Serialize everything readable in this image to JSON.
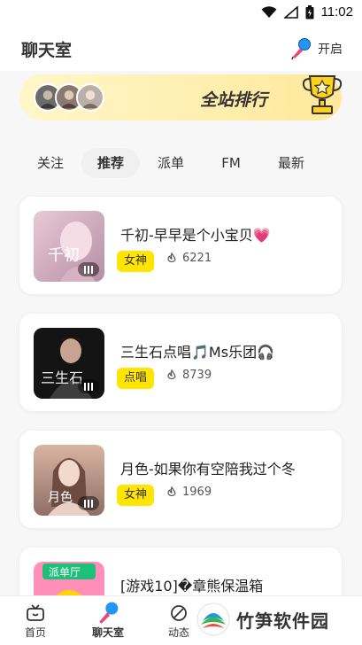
{
  "status": {
    "time": "11:02"
  },
  "header": {
    "title": "聊天室",
    "open_label": "开启"
  },
  "rank_banner": {
    "title": "全站排行"
  },
  "tabs": [
    {
      "label": "关注",
      "active": false
    },
    {
      "label": "推荐",
      "active": true
    },
    {
      "label": "派单",
      "active": false
    },
    {
      "label": "FM",
      "active": false
    },
    {
      "label": "最新",
      "active": false
    }
  ],
  "rooms": [
    {
      "name": "千初-早早是个小宝贝💗",
      "tag": "女神",
      "heat": "6221"
    },
    {
      "name": "三生石点唱🎵Ms乐团🎧",
      "tag": "点唱",
      "heat": "8739"
    },
    {
      "name": "月色-如果你有空陪我过个冬",
      "tag": "女神",
      "heat": "1969"
    },
    {
      "name": "[游戏10]�章熊保温箱",
      "tag": "",
      "heat": ""
    }
  ],
  "cover_text": {
    "r0": "千初",
    "r1": "三生石",
    "r2": "月色",
    "r3": "派单厅"
  },
  "bottom_nav": [
    {
      "label": "首页"
    },
    {
      "label": "聊天室"
    },
    {
      "label": "动态"
    }
  ],
  "watermark": {
    "text": "竹笋软件园"
  },
  "colors": {
    "tag_yellow": "#ffe500",
    "banner": "#fff2b8",
    "accent_blue": "#2196f3"
  }
}
